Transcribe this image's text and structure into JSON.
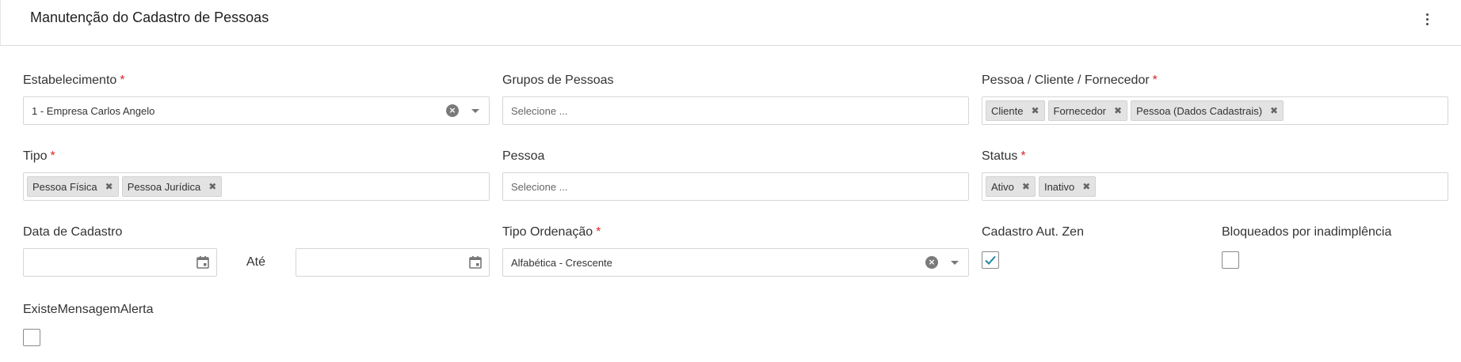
{
  "header": {
    "title": "Manutenção do Cadastro de Pessoas",
    "menu_icon": "kebab-menu-icon"
  },
  "form": {
    "estabelecimento": {
      "label": "Estabelecimento",
      "required": "*",
      "value": "1 - Empresa Carlos Angelo"
    },
    "grupos_pessoas": {
      "label": "Grupos de Pessoas",
      "placeholder": "Selecione ..."
    },
    "pessoa_cliente_fornecedor": {
      "label": "Pessoa / Cliente / Fornecedor",
      "required": "*",
      "tags": [
        "Cliente",
        "Fornecedor",
        "Pessoa (Dados Cadastrais)"
      ]
    },
    "tipo": {
      "label": "Tipo",
      "required": "*",
      "tags": [
        "Pessoa Física",
        "Pessoa Jurídica"
      ]
    },
    "pessoa": {
      "label": "Pessoa",
      "placeholder": "Selecione ..."
    },
    "status": {
      "label": "Status",
      "required": "*",
      "tags": [
        "Ativo",
        "Inativo"
      ]
    },
    "data_cadastro": {
      "label": "Data de Cadastro",
      "from_value": "",
      "to_label": "Até",
      "to_value": ""
    },
    "tipo_ordenacao": {
      "label": "Tipo Ordenação",
      "required": "*",
      "value": "Alfabética - Crescente"
    },
    "cadastro_aut_zen": {
      "label": "Cadastro Aut. Zen",
      "checked": true
    },
    "bloqueados": {
      "label": "Bloqueados por inadimplência",
      "checked": false
    },
    "existe_mensagem": {
      "label": "ExisteMensagemAlerta",
      "checked": false
    }
  },
  "tag_remove_glyph": "✖",
  "clear_glyph": "×",
  "colors": {
    "required": "#d8262b",
    "accent": "#1e88a8",
    "tag_bg": "#e3e3e3"
  }
}
